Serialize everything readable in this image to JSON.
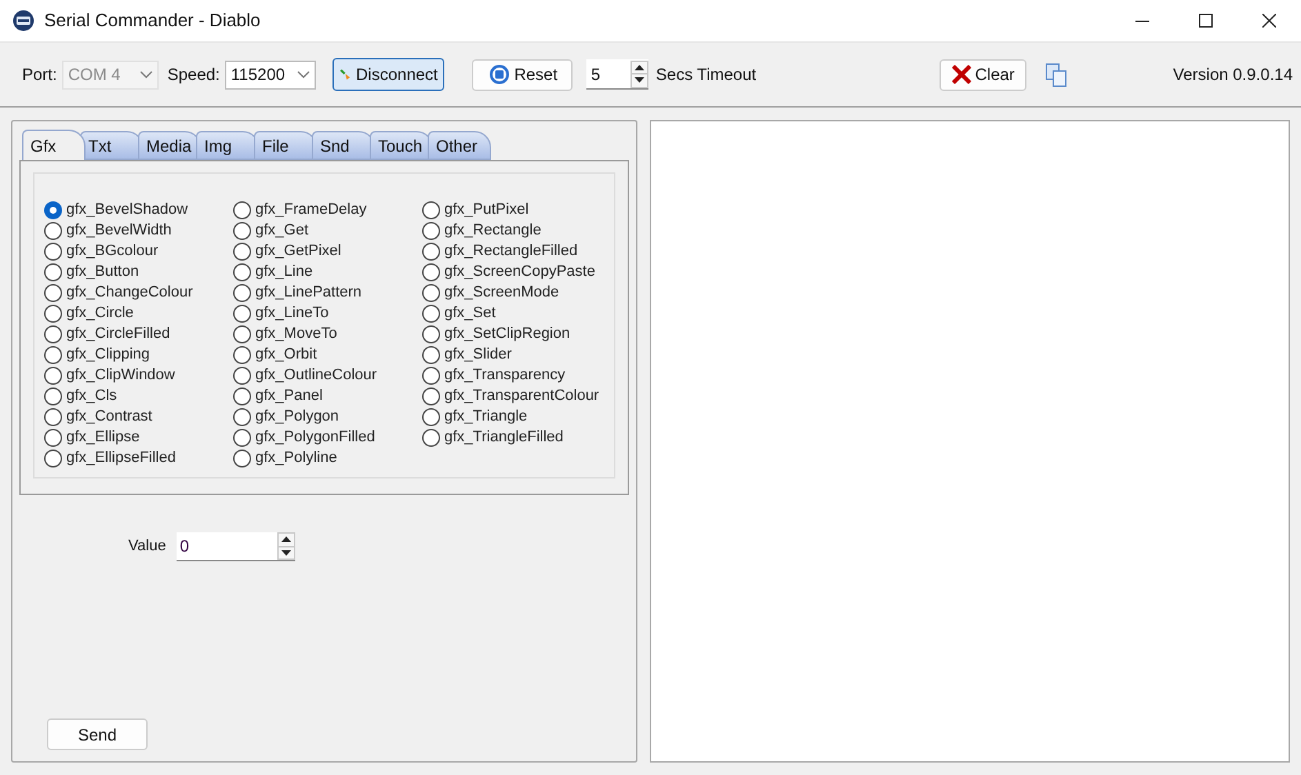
{
  "window": {
    "title": "Serial Commander - Diablo"
  },
  "toolbar": {
    "port_label": "Port:",
    "port_value": "COM 4",
    "port_disabled": true,
    "speed_label": "Speed:",
    "speed_value": "115200",
    "disconnect": "Disconnect",
    "reset": "Reset",
    "timeout_value": "5",
    "timeout_label": "Secs Timeout",
    "clear": "Clear",
    "version": "Version 0.9.0.14"
  },
  "tabs": [
    {
      "label": "Gfx",
      "selected": true
    },
    {
      "label": "Txt",
      "selected": false
    },
    {
      "label": "Media",
      "selected": false
    },
    {
      "label": "Img",
      "selected": false
    },
    {
      "label": "File",
      "selected": false
    },
    {
      "label": "Snd",
      "selected": false
    },
    {
      "label": "Touch",
      "selected": false
    },
    {
      "label": "Other",
      "selected": false
    }
  ],
  "commands": [
    [
      {
        "label": "gfx_BevelShadow",
        "selected": true
      },
      {
        "label": "gfx_BevelWidth",
        "selected": false
      },
      {
        "label": "gfx_BGcolour",
        "selected": false
      },
      {
        "label": "gfx_Button",
        "selected": false
      },
      {
        "label": "gfx_ChangeColour",
        "selected": false
      },
      {
        "label": "gfx_Circle",
        "selected": false
      },
      {
        "label": "gfx_CircleFilled",
        "selected": false
      },
      {
        "label": "gfx_Clipping",
        "selected": false
      },
      {
        "label": "gfx_ClipWindow",
        "selected": false
      },
      {
        "label": "gfx_Cls",
        "selected": false
      },
      {
        "label": "gfx_Contrast",
        "selected": false
      },
      {
        "label": "gfx_Ellipse",
        "selected": false
      },
      {
        "label": "gfx_EllipseFilled",
        "selected": false
      }
    ],
    [
      {
        "label": "gfx_FrameDelay",
        "selected": false
      },
      {
        "label": "gfx_Get",
        "selected": false
      },
      {
        "label": "gfx_GetPixel",
        "selected": false
      },
      {
        "label": "gfx_Line",
        "selected": false
      },
      {
        "label": "gfx_LinePattern",
        "selected": false
      },
      {
        "label": "gfx_LineTo",
        "selected": false
      },
      {
        "label": "gfx_MoveTo",
        "selected": false
      },
      {
        "label": "gfx_Orbit",
        "selected": false
      },
      {
        "label": "gfx_OutlineColour",
        "selected": false
      },
      {
        "label": "gfx_Panel",
        "selected": false
      },
      {
        "label": "gfx_Polygon",
        "selected": false
      },
      {
        "label": "gfx_PolygonFilled",
        "selected": false
      },
      {
        "label": "gfx_Polyline",
        "selected": false
      }
    ],
    [
      {
        "label": "gfx_PutPixel",
        "selected": false
      },
      {
        "label": "gfx_Rectangle",
        "selected": false
      },
      {
        "label": "gfx_RectangleFilled",
        "selected": false
      },
      {
        "label": "gfx_ScreenCopyPaste",
        "selected": false
      },
      {
        "label": "gfx_ScreenMode",
        "selected": false
      },
      {
        "label": "gfx_Set",
        "selected": false
      },
      {
        "label": "gfx_SetClipRegion",
        "selected": false
      },
      {
        "label": "gfx_Slider",
        "selected": false
      },
      {
        "label": "gfx_Transparency",
        "selected": false
      },
      {
        "label": "gfx_TransparentColour",
        "selected": false
      },
      {
        "label": "gfx_Triangle",
        "selected": false
      },
      {
        "label": "gfx_TriangleFilled",
        "selected": false
      }
    ]
  ],
  "value": {
    "label": "Value",
    "value": "0"
  },
  "send": "Send"
}
